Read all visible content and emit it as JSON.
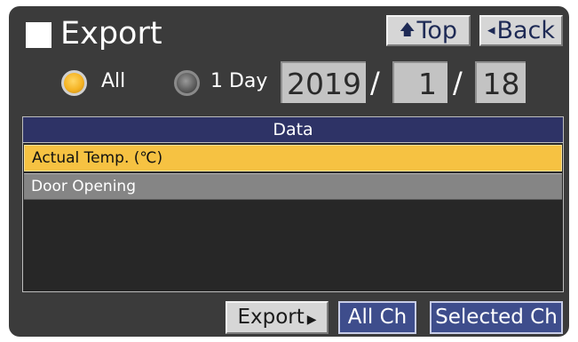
{
  "header": {
    "title": "Export",
    "top_button": {
      "label": "Top",
      "icon": "up-arrow-icon"
    },
    "back_button": {
      "label": "Back",
      "icon": "left-triangle-icon"
    }
  },
  "range": {
    "selected": "All",
    "options": [
      {
        "label": "All",
        "selected": true
      },
      {
        "label": "1 Day",
        "selected": false
      }
    ],
    "date": {
      "year": "2019",
      "month": "1",
      "day": "18",
      "separator": "/"
    }
  },
  "data_panel": {
    "header": "Data",
    "rows": [
      {
        "label": "Actual Temp. (℃)",
        "selected": true
      },
      {
        "label": "Door Opening",
        "selected": false
      }
    ]
  },
  "footer": {
    "export_label": "Export",
    "all_ch_label": "All Ch",
    "selected_ch_label": "Selected Ch"
  },
  "colors": {
    "background": "#3b3b3b",
    "selected_row": "#f6c242",
    "header_bar": "#2e3366",
    "channel_button": "#3e4d8c",
    "radio_active": "#f5b323"
  }
}
